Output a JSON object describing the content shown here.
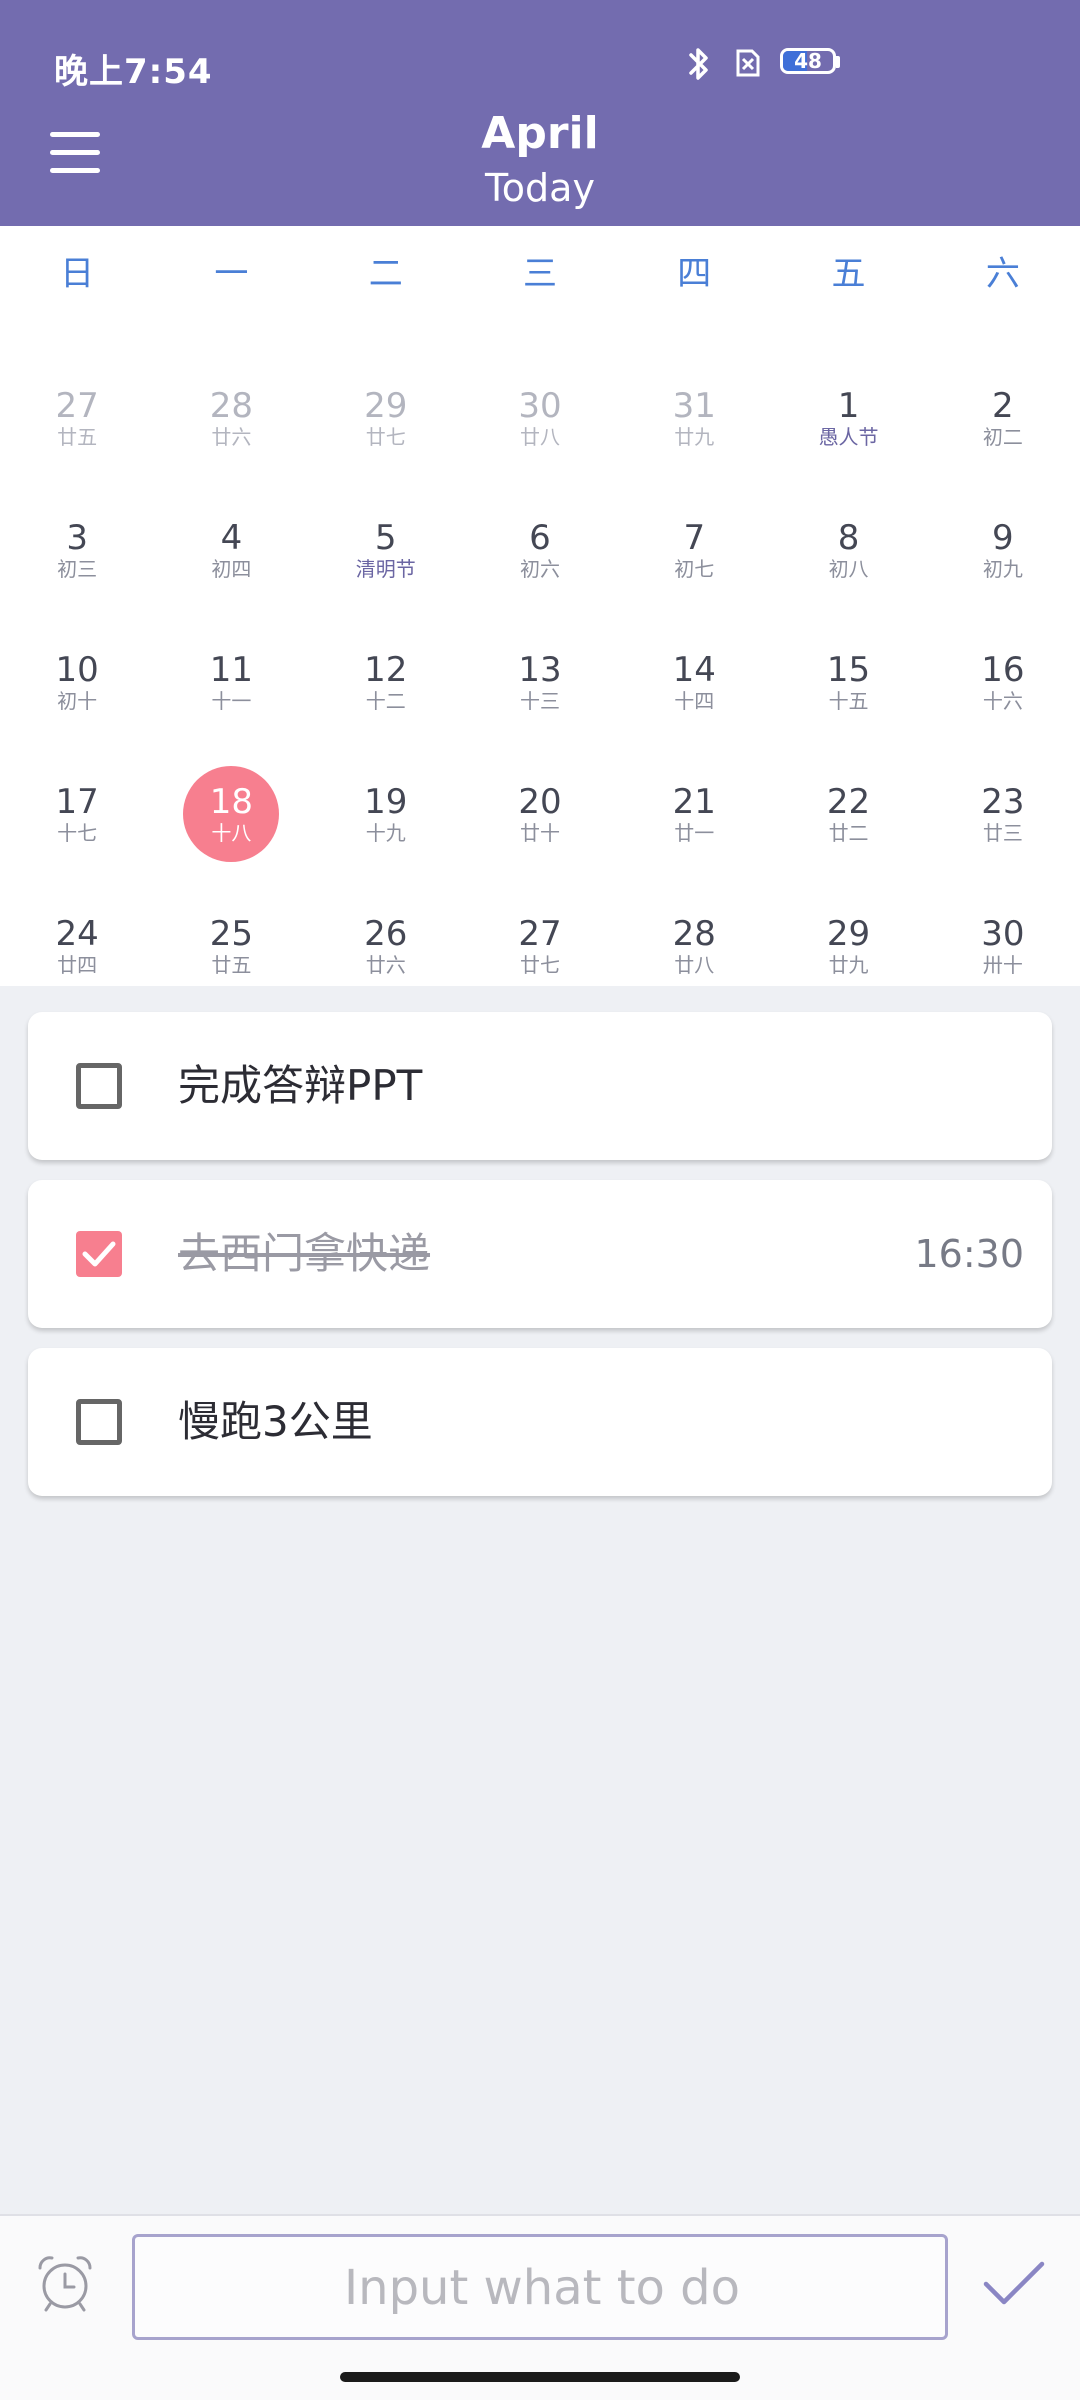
{
  "status_bar": {
    "time": "晚上7:54",
    "battery": "48",
    "battery_level": 0.48
  },
  "header": {
    "month": "April",
    "subtitle": "Today"
  },
  "calendar": {
    "weekdays": [
      "日",
      "一",
      "二",
      "三",
      "四",
      "五",
      "六"
    ],
    "days": [
      {
        "day": "27",
        "lunar": "廿五",
        "state": "other"
      },
      {
        "day": "28",
        "lunar": "廿六",
        "state": "other"
      },
      {
        "day": "29",
        "lunar": "廿七",
        "state": "other"
      },
      {
        "day": "30",
        "lunar": "廿八",
        "state": "other"
      },
      {
        "day": "31",
        "lunar": "廿九",
        "state": "other"
      },
      {
        "day": "1",
        "lunar": "愚人节",
        "state": "holiday"
      },
      {
        "day": "2",
        "lunar": "初二",
        "state": "normal"
      },
      {
        "day": "3",
        "lunar": "初三",
        "state": "normal"
      },
      {
        "day": "4",
        "lunar": "初四",
        "state": "normal"
      },
      {
        "day": "5",
        "lunar": "清明节",
        "state": "holiday"
      },
      {
        "day": "6",
        "lunar": "初六",
        "state": "normal"
      },
      {
        "day": "7",
        "lunar": "初七",
        "state": "normal"
      },
      {
        "day": "8",
        "lunar": "初八",
        "state": "normal"
      },
      {
        "day": "9",
        "lunar": "初九",
        "state": "normal"
      },
      {
        "day": "10",
        "lunar": "初十",
        "state": "normal"
      },
      {
        "day": "11",
        "lunar": "十一",
        "state": "normal"
      },
      {
        "day": "12",
        "lunar": "十二",
        "state": "normal"
      },
      {
        "day": "13",
        "lunar": "十三",
        "state": "normal"
      },
      {
        "day": "14",
        "lunar": "十四",
        "state": "normal"
      },
      {
        "day": "15",
        "lunar": "十五",
        "state": "normal"
      },
      {
        "day": "16",
        "lunar": "十六",
        "state": "normal"
      },
      {
        "day": "17",
        "lunar": "十七",
        "state": "normal"
      },
      {
        "day": "18",
        "lunar": "十八",
        "state": "selected"
      },
      {
        "day": "19",
        "lunar": "十九",
        "state": "normal"
      },
      {
        "day": "20",
        "lunar": "廿十",
        "state": "normal"
      },
      {
        "day": "21",
        "lunar": "廿一",
        "state": "normal"
      },
      {
        "day": "22",
        "lunar": "廿二",
        "state": "normal"
      },
      {
        "day": "23",
        "lunar": "廿三",
        "state": "normal"
      },
      {
        "day": "24",
        "lunar": "廿四",
        "state": "normal"
      },
      {
        "day": "25",
        "lunar": "廿五",
        "state": "normal"
      },
      {
        "day": "26",
        "lunar": "廿六",
        "state": "normal"
      },
      {
        "day": "27",
        "lunar": "廿七",
        "state": "normal"
      },
      {
        "day": "28",
        "lunar": "廿八",
        "state": "normal"
      },
      {
        "day": "29",
        "lunar": "廿九",
        "state": "normal"
      },
      {
        "day": "30",
        "lunar": "卅十",
        "state": "normal"
      }
    ]
  },
  "tasks": [
    {
      "text": "完成答辩PPT",
      "done": false,
      "time": ""
    },
    {
      "text": "去西门拿快递",
      "done": true,
      "time": "16:30"
    },
    {
      "text": "慢跑3公里",
      "done": false,
      "time": ""
    }
  ],
  "input": {
    "placeholder": "Input what to do",
    "value": ""
  },
  "icons": {
    "menu": "hamburger-menu-icon",
    "alarm": "alarm-clock-icon",
    "confirm": "checkmark-icon",
    "bluetooth": "bluetooth-icon",
    "sim": "no-sim-icon",
    "battery": "battery-icon"
  },
  "colors": {
    "header_bg": "#736caf",
    "accent_pink": "#f77f8f",
    "weekday_blue": "#4a7fd6",
    "background": "#eef0f4"
  }
}
